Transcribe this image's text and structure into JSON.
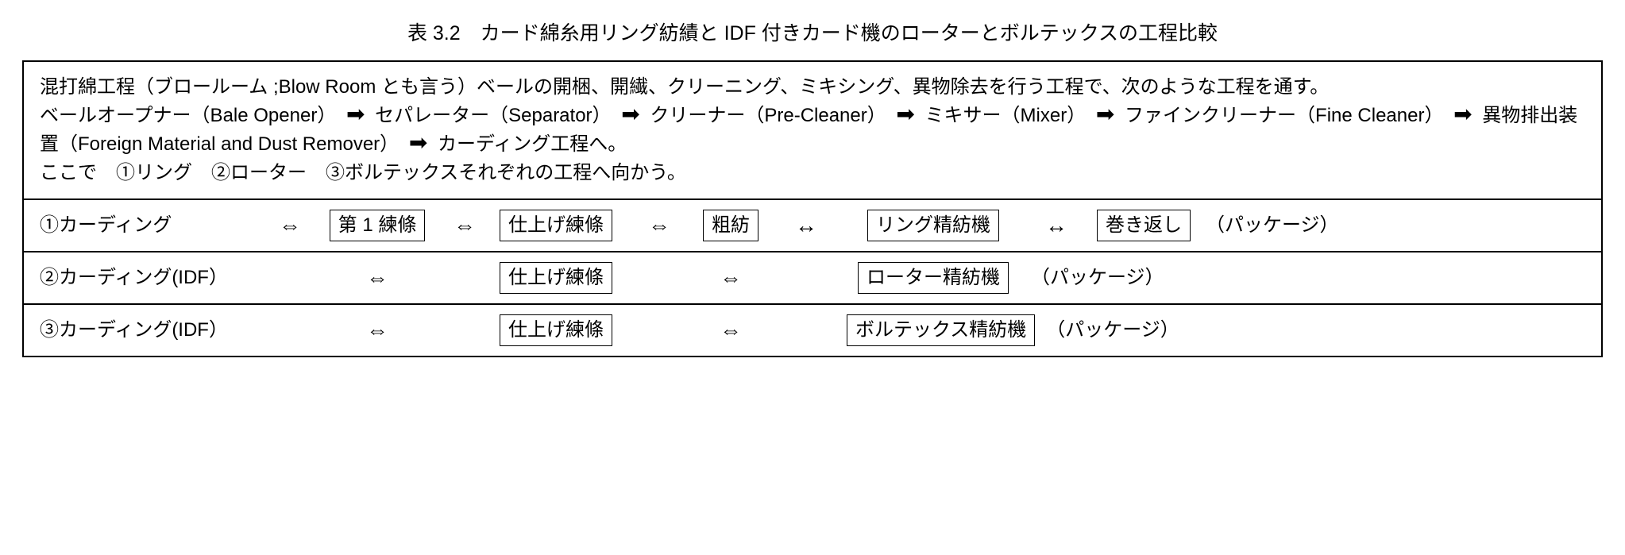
{
  "title": "表 3.2　カード綿糸用リング紡績と IDF 付きカード機のローターとボルテックスの工程比較",
  "intro": {
    "line1": "混打綿工程（ブロールーム ;Blow Room とも言う）ベールの開梱、開繊、クリーニング、ミキシング、異物除去を行う工程で、次のような工程を通す。",
    "line2a": "ベールオープナー（Bale Opener）",
    "line2b": "セパレーター（Separator）",
    "line2c": "クリーナー（Pre-Cleaner）",
    "line2d": "ミキサー（Mixer）",
    "line2e": "ファインクリーナー（Fine Cleaner）",
    "line2f": "異物排出装置（Foreign Material and Dust Remover）",
    "line2g": "カーディング工程へ。",
    "line3": "ここで　①リング　②ローター　③ボルテックスそれぞれの工程へ向かう。"
  },
  "arrows": {
    "open": "⇔",
    "solidRight": "➡",
    "solidBoth": "↔"
  },
  "rows": {
    "r1": {
      "first": "①カーディング",
      "b1": "第 1 練條",
      "b2": "仕上げ練條",
      "b3": "粗紡",
      "b4": "リング精紡機",
      "b5": "巻き返し",
      "suffix": "（パッケージ）"
    },
    "r2": {
      "first": "②カーディング(IDF）",
      "b2": "仕上げ練條",
      "b4": "ローター精紡機",
      "suffix": "（パッケージ）"
    },
    "r3": {
      "first": "③カーディング(IDF）",
      "b2": "仕上げ練條",
      "b4": "ボルテックス精紡機",
      "suffix": "（パッケージ）"
    }
  }
}
